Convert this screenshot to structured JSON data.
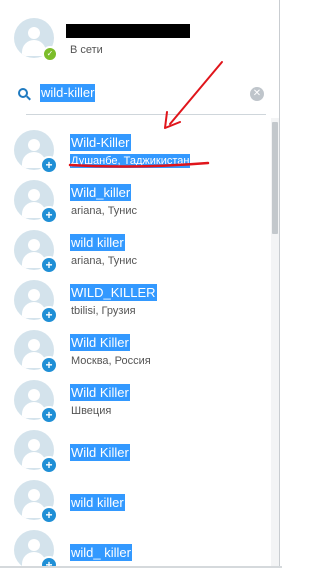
{
  "profile": {
    "status": "В сети",
    "status_icon": "check-icon"
  },
  "search": {
    "query": "wild-killer",
    "clear_icon": "clear-icon"
  },
  "results": [
    {
      "name": "Wild-Killer",
      "location": "Душанбе, Таджикистан"
    },
    {
      "name": "Wild_killer",
      "location": "ariana, Тунис"
    },
    {
      "name": "wild killer",
      "location": "ariana, Тунис"
    },
    {
      "name": "WILD_KILLER",
      "location": "tbilisi, Грузия"
    },
    {
      "name": "Wild Killer",
      "location": "Москва, Россия"
    },
    {
      "name": "Wild Killer",
      "location": "Швеция"
    },
    {
      "name": "Wild Killer",
      "location": ""
    },
    {
      "name": "wild killer",
      "location": ""
    },
    {
      "name": "wild_ killer",
      "location": ""
    }
  ],
  "colors": {
    "selection": "#3399ff",
    "online": "#7cbd2a",
    "add_badge": "#1f8fd6",
    "annotation": "#e0151b"
  }
}
